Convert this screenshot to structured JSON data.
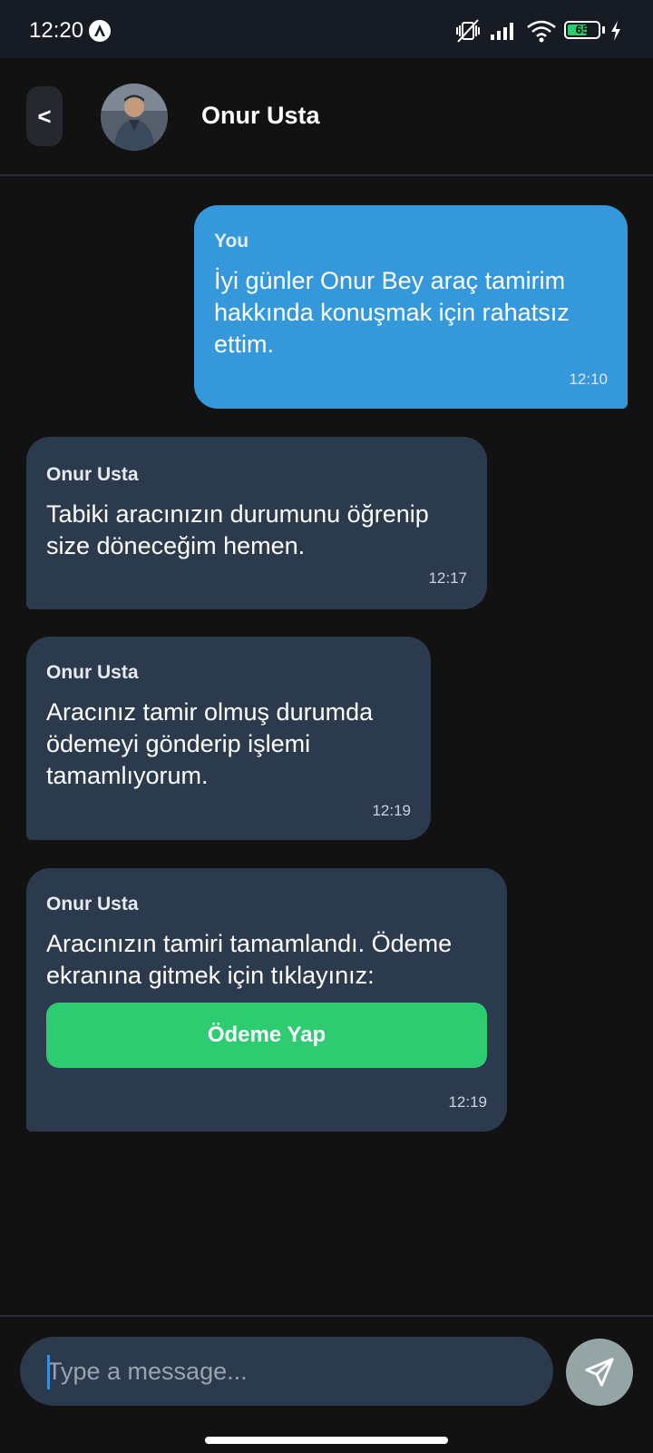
{
  "status_bar": {
    "time": "12:20",
    "battery_level": "65",
    "battery_fraction": 0.65,
    "icons": [
      "app-notification-icon",
      "vibrate-off-icon",
      "signal-icon",
      "wifi-icon",
      "battery-icon",
      "charging-icon"
    ]
  },
  "header": {
    "back_label": "<",
    "contact_name": "Onur Usta"
  },
  "messages": [
    {
      "sender": "You",
      "text": "İyi günler Onur Bey araç tamirim hakkında konuşmak için rahatsız ettim.",
      "time": "12:10",
      "outgoing": true
    },
    {
      "sender": "Onur Usta",
      "text": "Tabiki aracınızın durumunu öğrenip size döneceğim hemen.",
      "time": "12:17",
      "outgoing": false
    },
    {
      "sender": "Onur Usta",
      "text": "Aracınız tamir olmuş durumda ödemeyi gönderip işlemi tamamlıyorum.",
      "time": "12:19",
      "outgoing": false
    },
    {
      "sender": "Onur Usta",
      "text": "Aracınızın tamiri tamamlandı. Ödeme ekranına gitmek için tıklayınız:",
      "time": "12:19",
      "outgoing": false,
      "action_label": "Ödeme Yap"
    }
  ],
  "composer": {
    "placeholder": "Type a message...",
    "value": ""
  },
  "colors": {
    "background": "#121212",
    "outgoing_bubble": "#3498db",
    "incoming_bubble": "#2c3a4e",
    "pay_button": "#2ecc71",
    "send_button": "#95a5a6"
  }
}
